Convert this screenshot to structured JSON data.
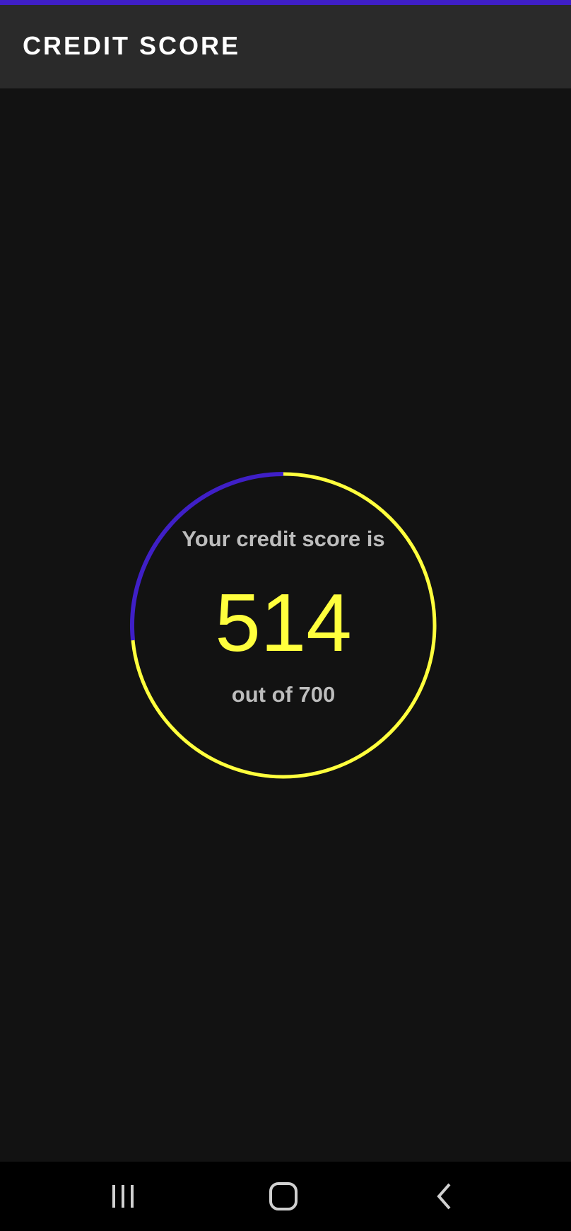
{
  "app_bar": {
    "title": "CREDIT SCORE"
  },
  "score_card": {
    "label_top": "Your credit score is",
    "score": "514",
    "label_bottom": "out of 700",
    "progress": {
      "value": 514,
      "max": 700,
      "fraction": 0.734
    }
  },
  "colors": {
    "accent": "#3f1fc7",
    "score": "#ffff3d",
    "track": "#ffff3d",
    "background": "#121212",
    "app_bar": "#2a2a2a"
  },
  "nav_bar": {
    "icons": [
      "recent-apps-icon",
      "home-icon",
      "back-icon"
    ]
  }
}
